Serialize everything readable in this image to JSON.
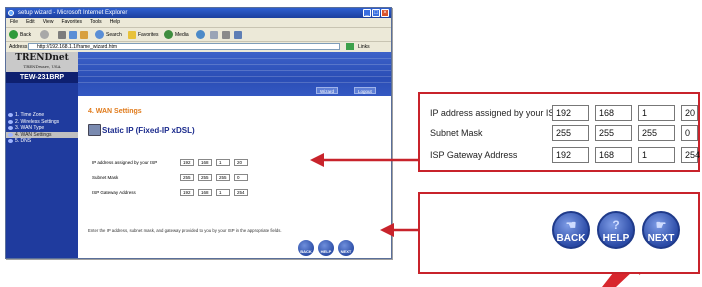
{
  "browser": {
    "title": "setup wizard - Microsoft Internet Explorer",
    "menu": [
      "File",
      "Edit",
      "View",
      "Favorites",
      "Tools",
      "Help"
    ],
    "toolbar": {
      "back": "Back",
      "search": "Search",
      "favorites": "Favorites",
      "media": "Media"
    },
    "address_label": "Address",
    "address_value": "http://192.168.1.1/frame_wizard.htm",
    "go": "Go",
    "links": "Links"
  },
  "router": {
    "brand": "TRENDnet",
    "brand_sub": "TRENDware, USA",
    "model": "TEW-231BRP",
    "nav": [
      {
        "label": "1. Time Zone"
      },
      {
        "label": "2. Wireless Settings"
      },
      {
        "label": "3. WAN Type"
      },
      {
        "label": "4. WAN Settings"
      },
      {
        "label": "5. DNS"
      }
    ],
    "top_buttons": [
      "Wizard",
      "Logout"
    ]
  },
  "wan": {
    "section_title": "4. WAN Settings",
    "mode_title": "Static IP (Fixed-IP xDSL)",
    "fields": [
      {
        "label": "IP address assigned by your ISP",
        "octets": [
          "192",
          "168",
          "1",
          "20"
        ]
      },
      {
        "label": "Subnet Mask",
        "octets": [
          "255",
          "255",
          "255",
          "0"
        ]
      },
      {
        "label": "ISP Gateway Address",
        "octets": [
          "192",
          "168",
          "1",
          "254"
        ]
      }
    ],
    "instructions": "Enter the IP address, subnet mask, and gateway provided to you by your ISP in the appropriate fields.",
    "buttons": {
      "back": "BACK",
      "help": "HELP",
      "next": "NEXT"
    }
  },
  "colors": {
    "callout_red": "#c8232b",
    "nav_blue": "#1f3b9e",
    "title_orange": "#e07a1a"
  }
}
